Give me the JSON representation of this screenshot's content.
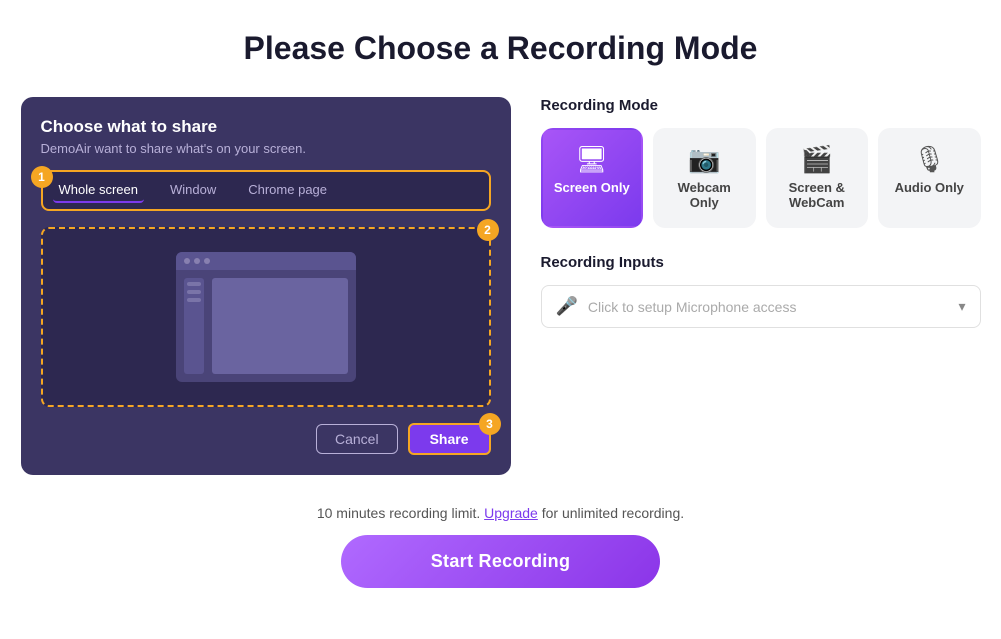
{
  "page": {
    "title": "Please Choose a Recording Mode"
  },
  "screen_share_panel": {
    "title": "Choose what to share",
    "subtitle": "DemoAir want to share what's on your screen.",
    "tabs": [
      {
        "label": "Whole screen",
        "active": true
      },
      {
        "label": "Window",
        "active": false
      },
      {
        "label": "Chrome page",
        "active": false
      }
    ],
    "step1": "1",
    "step2": "2",
    "step3": "3",
    "cancel_label": "Cancel",
    "share_label": "Share"
  },
  "recording_mode": {
    "section_label": "Recording Mode",
    "cards": [
      {
        "id": "screen-only",
        "label": "Screen Only",
        "icon": "🖥",
        "active": true
      },
      {
        "id": "webcam-only",
        "label": "Webcam Only",
        "icon": "📷",
        "active": false
      },
      {
        "id": "screen-webcam",
        "label": "Screen & WebCam",
        "icon": "🎬",
        "active": false
      },
      {
        "id": "audio-only",
        "label": "Audio Only",
        "icon": "🎙",
        "active": false
      }
    ]
  },
  "recording_inputs": {
    "section_label": "Recording Inputs",
    "mic_placeholder": "Click to setup Microphone access"
  },
  "footer": {
    "limit_text": "10 minutes recording limit.",
    "upgrade_label": "Upgrade",
    "upgrade_suffix": " for unlimited recording.",
    "start_btn_label": "Start Recording"
  }
}
